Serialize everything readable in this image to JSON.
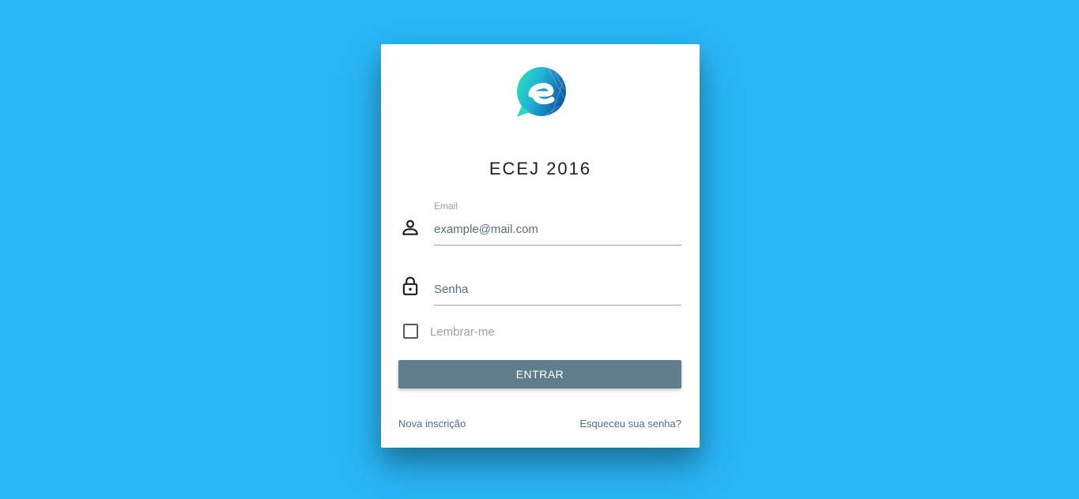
{
  "app": {
    "title": "ECEJ 2016",
    "logo_icon": "ecej-e-speech-bubble-logo"
  },
  "colors": {
    "background": "#29b6f6",
    "button": "#607d8b",
    "text_accent": "#546e7a"
  },
  "form": {
    "email": {
      "label": "Email",
      "value": "example@mail.com",
      "icon": "person-icon"
    },
    "password": {
      "placeholder": "Senha",
      "icon": "lock-icon"
    },
    "remember": {
      "label": "Lembrar-me",
      "checked": false
    },
    "submit_label": "ENTRAR"
  },
  "links": {
    "register": "Nova inscrição",
    "forgot_password": "Esqueceu sua senha?"
  }
}
